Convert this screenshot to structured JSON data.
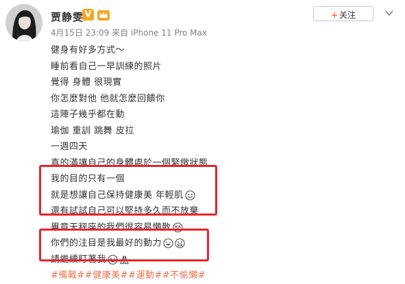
{
  "user": {
    "name": "贾静雯",
    "verified_badge": "V",
    "crown_icon": "crown-icon"
  },
  "post": {
    "meta": "4月15日 23:09 来自 iPhone 11 Pro Max",
    "lines": [
      "健身有好多方式～",
      "睡前看自己一早訓練的照片",
      "覺得 身體 很現實",
      "你怎麼對他 他就怎麼回饋你",
      "這陣子幾乎都在動",
      "瑜伽 重訓 跳舞 皮拉",
      "一週四天",
      "真的滿讓自己的身體處於一個緊緻狀態",
      "我的目的只有一個",
      "就是想讓自己保持健康美 年輕肌",
      "還有試試自己可以堅持多久而不放棄",
      "畢竟天秤座的我們很容易懶散",
      "你們的注目是我最好的動力",
      "請繼續盯著我"
    ],
    "tags": "#備戰##健康美##運動##不偷懶#"
  },
  "actions": {
    "follow_label": "关注",
    "follow_plus": "+"
  },
  "colors": {
    "highlight": "#e8242c",
    "tag": "#eb7350",
    "badge": "#f5a623",
    "follow_plus": "#f77234"
  }
}
